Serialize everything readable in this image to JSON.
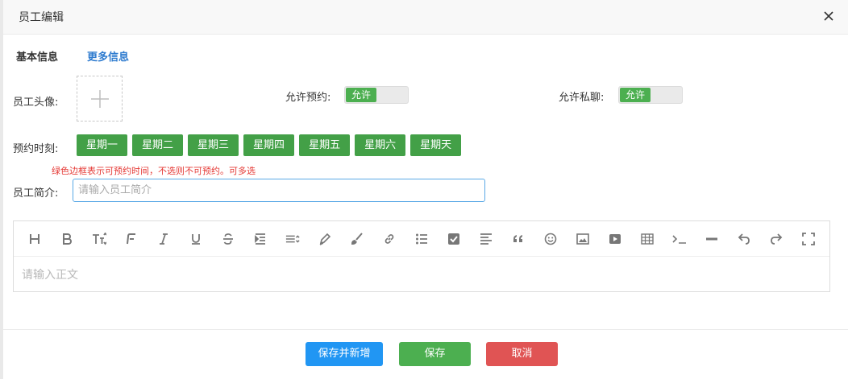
{
  "dialog": {
    "title": "员工编辑"
  },
  "tabs": [
    {
      "label": "基本信息"
    },
    {
      "label": "更多信息"
    }
  ],
  "form": {
    "avatar_label": "员工头像:",
    "allow_booking_label": "允许预约:",
    "allow_booking_toggle": "允许",
    "allow_chat_label": "允许私聊:",
    "allow_chat_toggle": "允许",
    "booking_time_label": "预约时刻:",
    "days": [
      "星期一",
      "星期二",
      "星期三",
      "星期四",
      "星期五",
      "星期六",
      "星期天"
    ],
    "hint": "绿色边框表示可预约时间，不选则不可预约。可多选",
    "intro_label": "员工简介:",
    "intro_placeholder": "请输入员工简介"
  },
  "editor": {
    "placeholder": "请输入正文",
    "toolbar_icons": [
      "heading-icon",
      "bold-icon",
      "font-size-icon",
      "font-family-icon",
      "italic-icon",
      "underline-icon",
      "strikethrough-icon",
      "indent-icon",
      "line-height-icon",
      "pen-icon",
      "brush-icon",
      "link-icon",
      "list-icon",
      "checkbox-icon",
      "align-icon",
      "quote-icon",
      "emoji-icon",
      "image-icon",
      "video-icon",
      "table-icon",
      "code-icon",
      "divider-icon",
      "undo-icon",
      "redo-icon",
      "fullscreen-icon"
    ]
  },
  "footer": {
    "save_new": "保存并新增",
    "save": "保存",
    "cancel": "取消"
  },
  "colors": {
    "green": "#43a047",
    "blue": "#2196f3",
    "red": "#e05454",
    "link": "#2e7bcf"
  }
}
